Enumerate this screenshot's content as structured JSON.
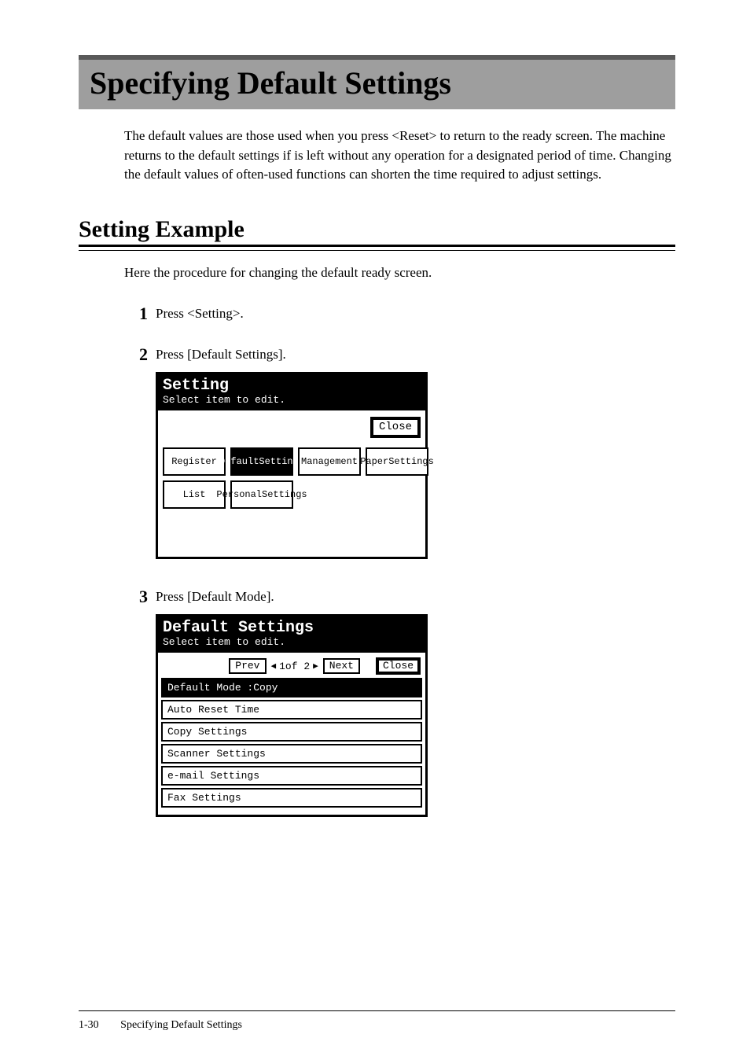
{
  "page_title": "Specifying Default Settings",
  "intro": "The default values are those used when you press <Reset> to return to the ready screen. The machine returns to the default settings if is left without any operation for a designated period of time. Changing the default values of often-used functions can shorten the time required to adjust settings.",
  "section_title": "Setting Example",
  "lead": "Here the procedure for changing the default ready screen.",
  "steps": {
    "s1": {
      "num": "1",
      "text": "Press <Setting>."
    },
    "s2": {
      "num": "2",
      "text": "Press [Default Settings]."
    },
    "s3": {
      "num": "3",
      "text": "Press [Default Mode]."
    }
  },
  "lcd1": {
    "title": "Setting",
    "subtitle": "Select item to edit.",
    "close": "Close",
    "btn_register": "Register",
    "btn_default_l1": "Default",
    "btn_default_l2": "Settings",
    "btn_management": "Management",
    "btn_paper_l1": "Paper",
    "btn_paper_l2": "Settings",
    "btn_list": "List",
    "btn_personal_l1": "Personal",
    "btn_personal_l2": "Settings"
  },
  "lcd2": {
    "title": "Default Settings",
    "subtitle": "Select item to edit.",
    "prev": "Prev",
    "next": "Next",
    "page_indicator": "1of  2",
    "left_tri": "◀",
    "right_tri": "▶",
    "close": "Close",
    "rows": {
      "r0": "Default Mode    :Copy",
      "r1": "Auto Reset Time",
      "r2": "Copy Settings",
      "r3": "Scanner Settings",
      "r4": "e-mail Settings",
      "r5": "Fax Settings"
    }
  },
  "footer": {
    "page_number": "1-30",
    "running_title": "Specifying Default Settings"
  }
}
